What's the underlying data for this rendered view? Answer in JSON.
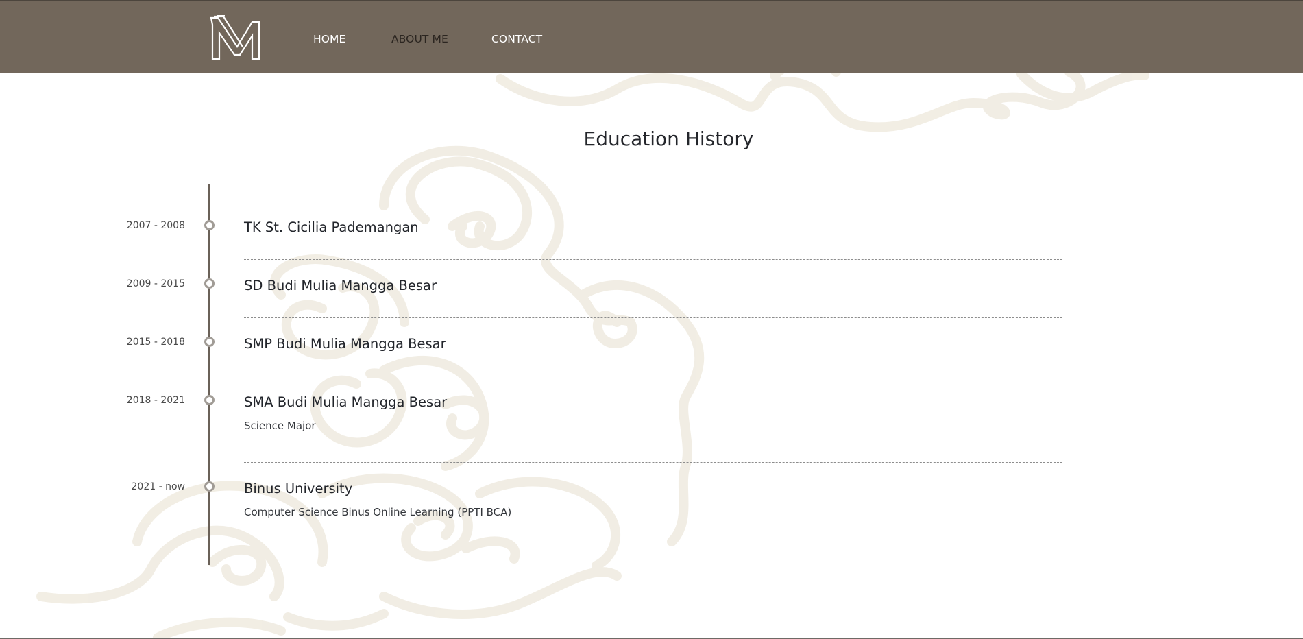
{
  "nav": {
    "logo_alt": "M",
    "links": [
      {
        "label": "HOME",
        "color": "#ffffff"
      },
      {
        "label": "ABOUT ME",
        "color": "#2b2520"
      },
      {
        "label": "CONTACT",
        "color": "#ffffff"
      }
    ]
  },
  "section": {
    "title": "Education History"
  },
  "timeline": [
    {
      "date": "2007 - 2008",
      "school": "TK St. Cicilia Pademangan",
      "desc": ""
    },
    {
      "date": "2009 - 2015",
      "school": "SD Budi Mulia Mangga Besar",
      "desc": ""
    },
    {
      "date": "2015 - 2018",
      "school": "SMP Budi Mulia Mangga Besar",
      "desc": ""
    },
    {
      "date": "2018 - 2021",
      "school": "SMA Budi Mulia Mangga Besar",
      "desc": "Science Major"
    },
    {
      "date": "2021 - now",
      "school": "Binus University",
      "desc": "Computer Science Binus Online Learning (PPTI BCA)"
    }
  ],
  "colors": {
    "navbar": "#72675b",
    "timeline_line": "#6a6158",
    "pattern": "#efeadf"
  }
}
